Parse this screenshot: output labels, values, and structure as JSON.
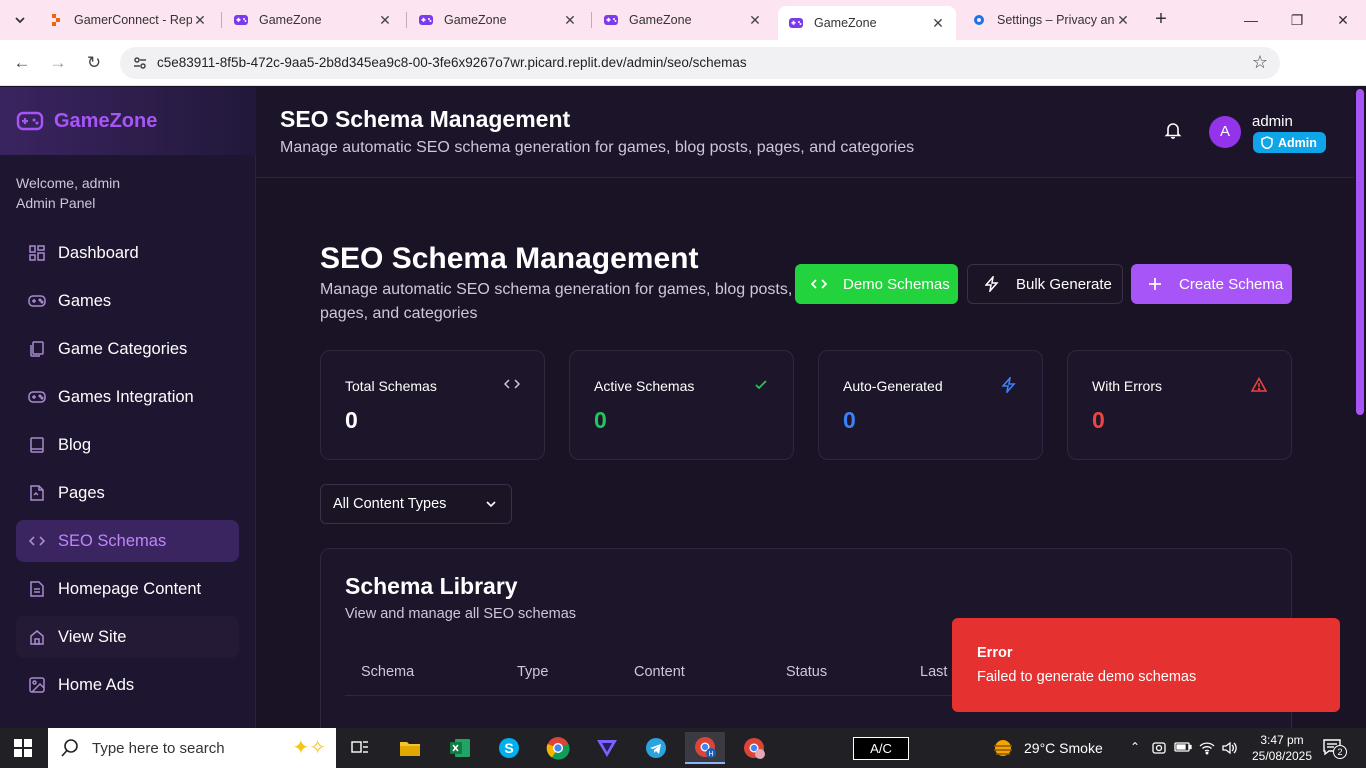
{
  "browser": {
    "tabs": [
      {
        "title": "GamerConnect - Repl",
        "icon": "replit-icon",
        "active": false
      },
      {
        "title": "GameZone",
        "icon": "gamepad-icon",
        "active": false
      },
      {
        "title": "GameZone",
        "icon": "gamepad-icon",
        "active": false
      },
      {
        "title": "GameZone",
        "icon": "gamepad-icon",
        "active": false
      },
      {
        "title": "GameZone",
        "icon": "gamepad-icon",
        "active": true
      },
      {
        "title": "Settings – Privacy and",
        "icon": "settings-gear-icon",
        "active": false
      }
    ],
    "url": "c5e83911-8f5b-472c-9aa5-2b8d345ea9c8-00-3fe6x9267o7wr.picard.replit.dev/admin/seo/schemas",
    "profile_initial": "H"
  },
  "sidebar": {
    "brand": "GameZone",
    "welcome_line1": "Welcome, admin",
    "welcome_line2": "Admin Panel",
    "items": [
      {
        "label": "Dashboard",
        "icon": "grid-icon"
      },
      {
        "label": "Games",
        "icon": "gamepad-icon"
      },
      {
        "label": "Game Categories",
        "icon": "copy-icon"
      },
      {
        "label": "Games Integration",
        "icon": "gamepad-icon"
      },
      {
        "label": "Blog",
        "icon": "book-icon"
      },
      {
        "label": "Pages",
        "icon": "file-icon"
      },
      {
        "label": "SEO Schemas",
        "icon": "code-icon",
        "active": true
      },
      {
        "label": "Homepage Content",
        "icon": "document-icon"
      },
      {
        "label": "View Site",
        "icon": "home-icon"
      },
      {
        "label": "Home Ads",
        "icon": "image-icon"
      }
    ]
  },
  "header": {
    "title": "SEO Schema Management",
    "subtitle": "Manage automatic SEO schema generation for games, blog posts, pages, and categories",
    "user_initial": "A",
    "username": "admin",
    "role_badge": "Admin"
  },
  "main": {
    "title": "SEO Schema Management",
    "subtitle": "Manage automatic SEO schema generation for games, blog posts, pages, and categories",
    "buttons": {
      "demo": "Demo Schemas",
      "bulk": "Bulk Generate",
      "create": "Create Schema"
    },
    "stats": [
      {
        "label": "Total Schemas",
        "value": "0",
        "icon": "code-icon",
        "color": "#ffffff"
      },
      {
        "label": "Active Schemas",
        "value": "0",
        "icon": "check-icon",
        "color": "#22c55e"
      },
      {
        "label": "Auto-Generated",
        "value": "0",
        "icon": "lightning-icon",
        "color": "#3b82f6"
      },
      {
        "label": "With Errors",
        "value": "0",
        "icon": "warning-icon",
        "color": "#ef4444"
      }
    ],
    "filter_value": "All Content Types",
    "library": {
      "title": "Schema Library",
      "subtitle": "View and manage all SEO schemas",
      "columns": [
        "Schema",
        "Type",
        "Content",
        "Status",
        "Last"
      ]
    }
  },
  "toast": {
    "title": "Error",
    "message": "Failed to generate demo schemas"
  },
  "taskbar": {
    "search_placeholder": "Type here to search",
    "ac_label": "A/C",
    "weather": "29°C  Smoke",
    "time": "3:47 pm",
    "date": "25/08/2025",
    "notification_count": "2"
  },
  "colors": {
    "accent": "#a855f7",
    "success": "#22d33d",
    "error": "#e5312f",
    "info": "#0ea5e9"
  }
}
